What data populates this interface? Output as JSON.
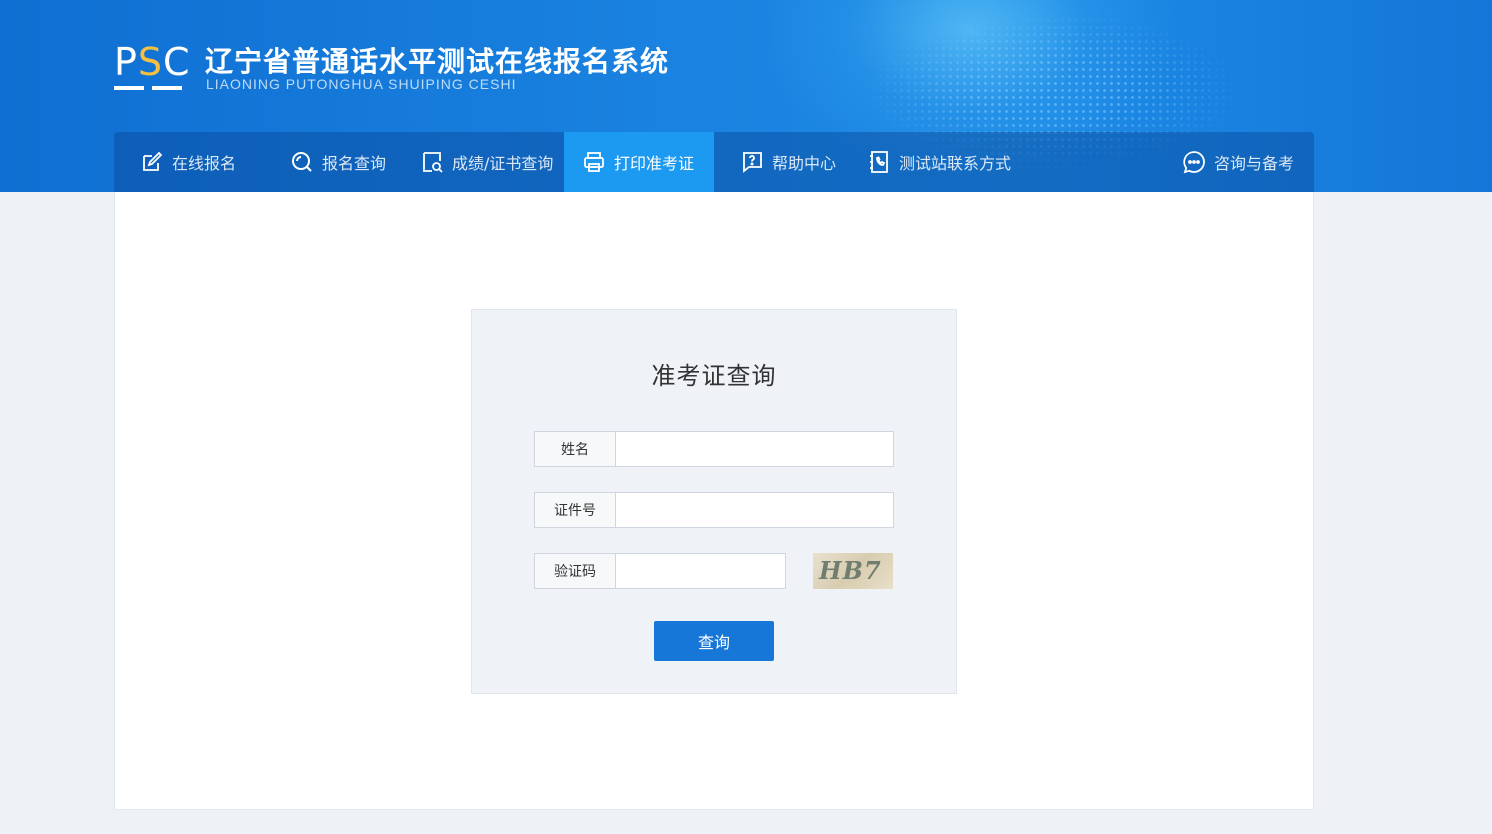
{
  "header": {
    "logo_prefix": "P",
    "logo_s": "S",
    "logo_suffix": "C",
    "title": "辽宁省普通话水平测试在线报名系统",
    "subtitle": "LIAONING PUTONGHUA SHUIPING CESHI"
  },
  "nav": {
    "items": [
      {
        "label": "在线报名",
        "icon": "edit-icon"
      },
      {
        "label": "报名查询",
        "icon": "search-circle-icon"
      },
      {
        "label": "成绩/证书查询",
        "icon": "document-search-icon"
      },
      {
        "label": "打印准考证",
        "icon": "printer-icon"
      },
      {
        "label": "帮助中心",
        "icon": "help-icon"
      },
      {
        "label": "测试站联系方式",
        "icon": "phone-book-icon"
      },
      {
        "label": "咨询与备考",
        "icon": "chat-icon"
      }
    ],
    "active_index": 3
  },
  "form": {
    "title": "准考证查询",
    "name_label": "姓名",
    "name_value": "",
    "id_label": "证件号",
    "id_value": "",
    "captcha_label": "验证码",
    "captcha_value": "",
    "captcha_text": "HB7",
    "submit_label": "查询"
  },
  "colors": {
    "header_blue": "#1a82e0",
    "active_tab": "#1c9af1",
    "button_blue": "#1677d9",
    "logo_accent": "#f5c042"
  }
}
